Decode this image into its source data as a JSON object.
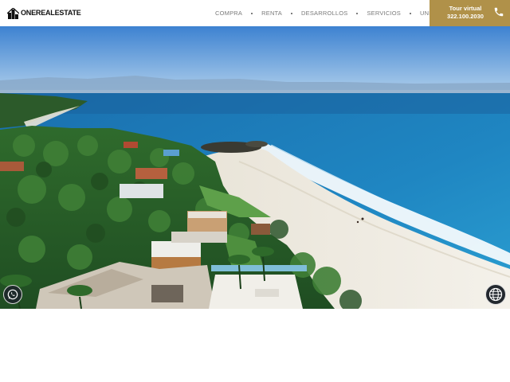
{
  "brand": {
    "name": "ONEREALESTATE",
    "logo_icon": "building-icon"
  },
  "nav": {
    "items": [
      {
        "label": "COMPRA"
      },
      {
        "label": "RENTA"
      },
      {
        "label": "DESARROLLOS"
      },
      {
        "label": "SERVICIOS"
      },
      {
        "label": "UNETE"
      }
    ]
  },
  "tour": {
    "label": "Tour virtual",
    "phone": "322.100.2030",
    "icon": "phone-icon"
  },
  "hero": {
    "image": "aerial-beach-coastline-photo",
    "description_icon": "landscape-image"
  },
  "floating": {
    "whatsapp_icon": "whatsapp-icon",
    "language_icon": "globe-icon"
  },
  "colors": {
    "accent": "#b09149",
    "nav_text": "#7a7a7a",
    "brand_text": "#111111"
  }
}
